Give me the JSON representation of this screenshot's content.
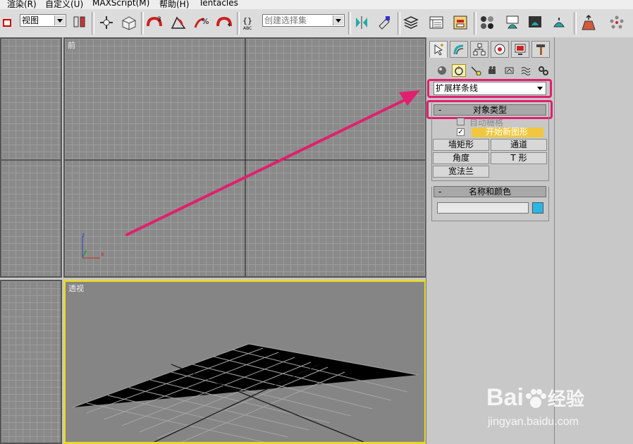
{
  "menubar": {
    "items": [
      "渲染(R)",
      "自定义(U)",
      "MAXScript(M)",
      "帮助(H)",
      "Tentacles"
    ]
  },
  "toolbar": {
    "view_combo": "视图",
    "selection_set_placeholder": "创建选择集",
    "snap_labels": [
      "3",
      "%"
    ]
  },
  "viewports": {
    "front_label": "前",
    "perspective_label": "透视",
    "axis": {
      "x": "x",
      "y": "y",
      "z": "z"
    }
  },
  "command_panel": {
    "category_dropdown": "扩展样条线",
    "object_type": {
      "header": "对象类型",
      "collapse": "-",
      "auto_grid_label": "自动栅格",
      "start_new_shape_label": "开始新图形",
      "start_new_shape_checked": "✓",
      "buttons": [
        "墙矩形",
        "通道",
        "角度",
        "T 形",
        "宽法兰"
      ]
    },
    "name_color": {
      "header": "名称和颜色",
      "collapse": "-",
      "name_value": "",
      "swatch_color": "#29b6e8"
    }
  },
  "annotations": {
    "highlight_color": "#e0206e"
  },
  "watermark": {
    "brand": "Bai",
    "brand_tail": "经验",
    "url": "jingyan.baidu.com"
  }
}
